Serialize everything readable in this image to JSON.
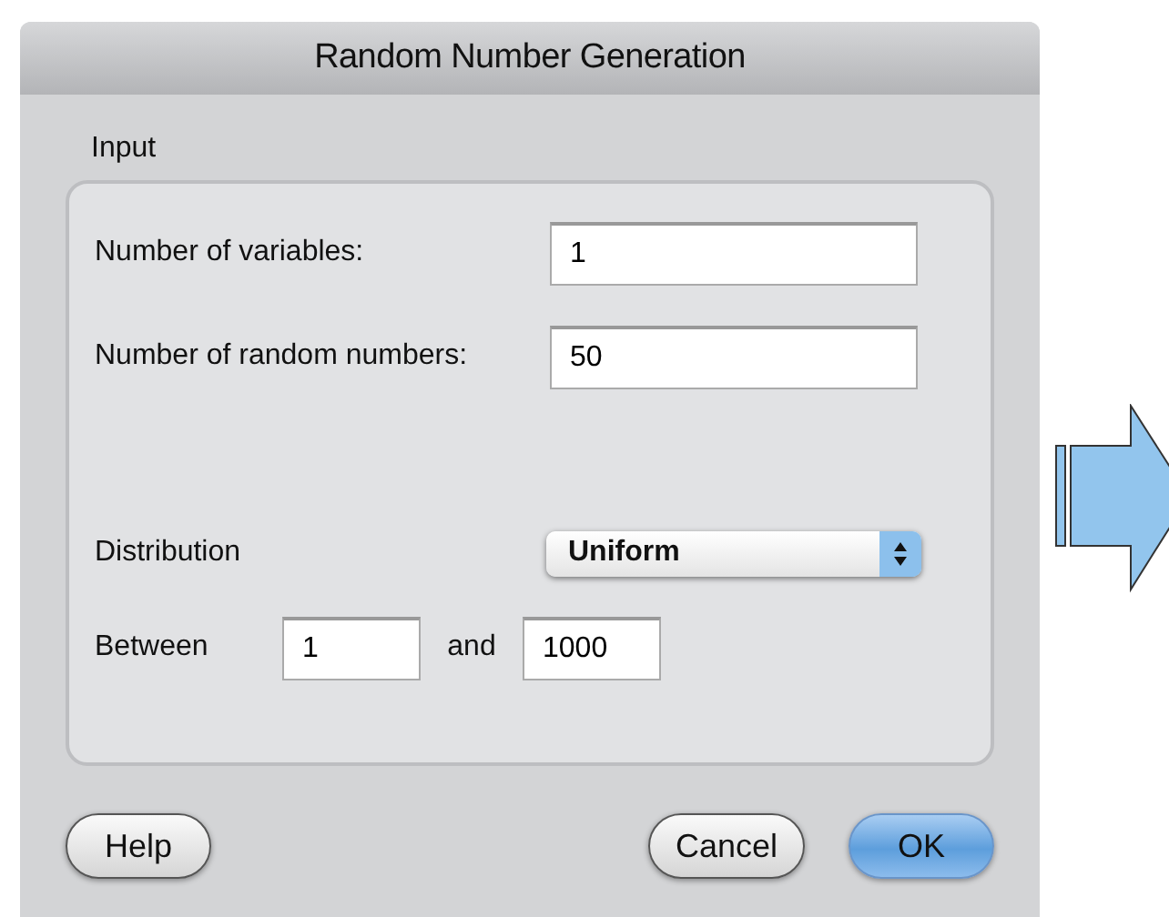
{
  "window": {
    "title": "Random Number Generation"
  },
  "input_group": {
    "label": "Input",
    "fields": [
      {
        "label": "Number of variables:",
        "value": "1"
      },
      {
        "label": "Number of random numbers:",
        "value": "50"
      }
    ],
    "distribution": {
      "label": "Distribution",
      "value": "Uniform"
    },
    "range": {
      "label": "Between",
      "from": "1",
      "joiner": "and",
      "to": "1000"
    }
  },
  "buttons": [
    {
      "label": "Help",
      "kind": "plain"
    },
    {
      "label": "Cancel",
      "kind": "plain"
    },
    {
      "label": "OK",
      "kind": "default"
    }
  ]
}
